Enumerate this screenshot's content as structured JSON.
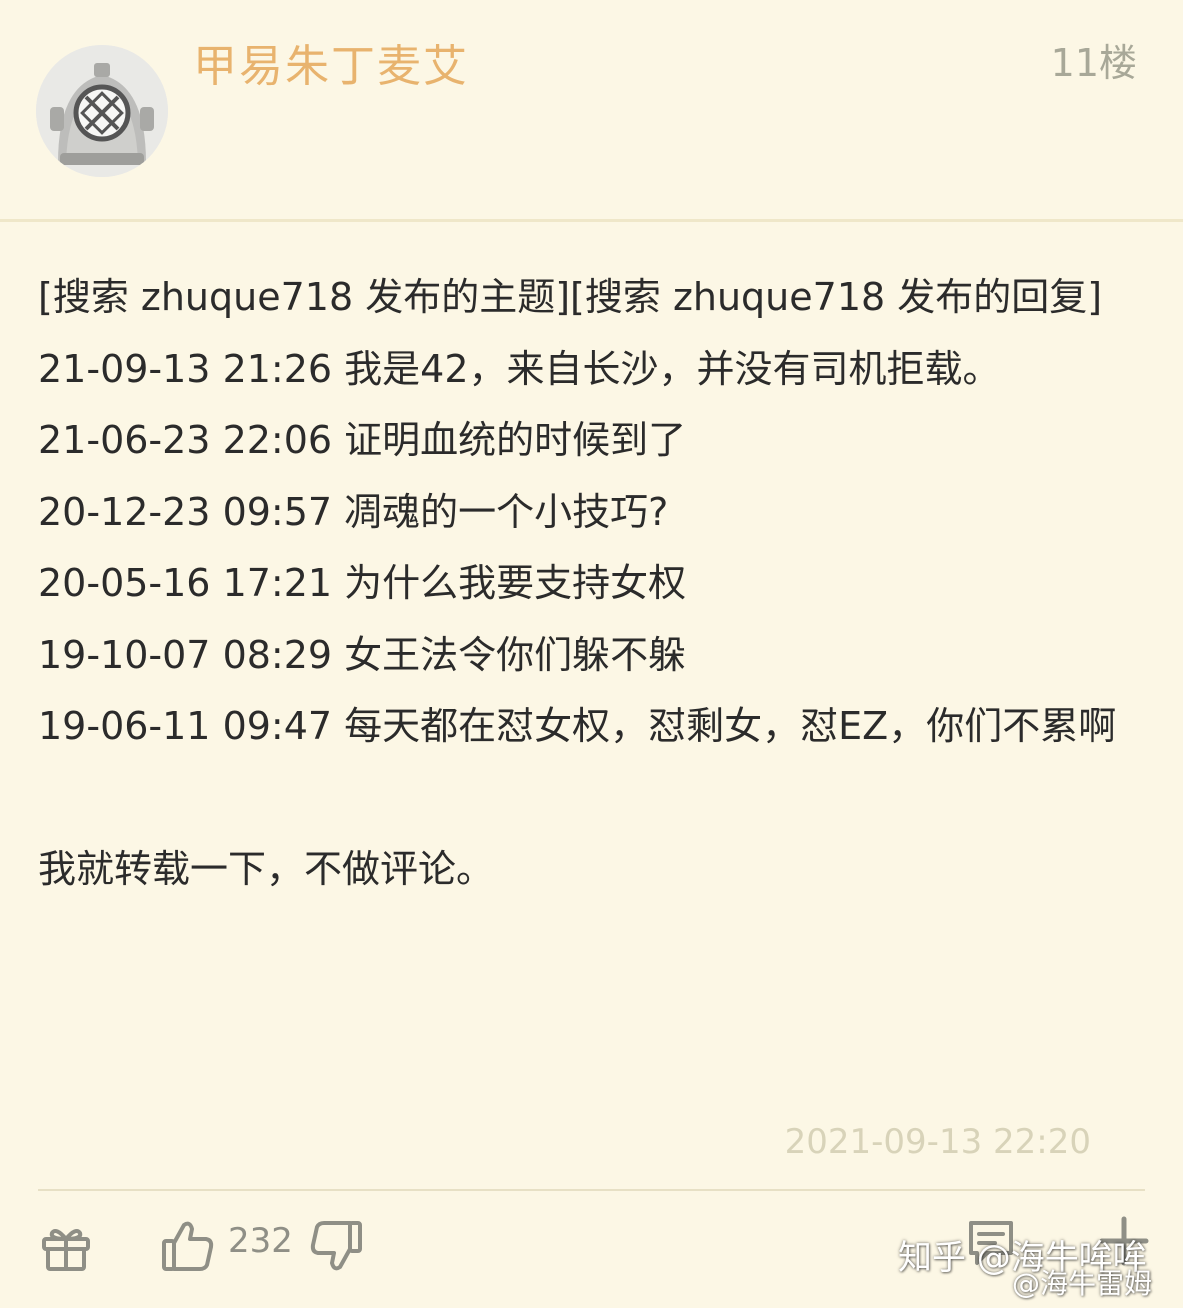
{
  "post": {
    "username": "甲易朱丁麦艾",
    "floor": "11楼",
    "lines": [
      "[搜索 zhuque718 发布的主题][搜索 zhuque718 发布的回复]",
      "21-09-13 21:26 我是42，来自长沙，并没有司机拒载。",
      "21-06-23 22:06 证明血统的时候到了",
      "20-12-23 09:57 凋魂的一个小技巧?",
      "20-05-16 17:21 为什么我要支持女权",
      "19-10-07 08:29 女王法令你们躲不躲",
      "19-06-11 09:47 每天都在怼女权，怼剩女，怼EZ，你们不累啊"
    ],
    "closing": "我就转载一下，不做评论。",
    "timestamp": "2021-09-13 22:20",
    "like_count": "232"
  },
  "watermark": {
    "line1": "知乎 @海牛哞哞",
    "line2": "@海牛雷姆"
  },
  "icons": {
    "avatar": "diving-helmet-avatar",
    "gift": "gift-icon",
    "like": "thumbs-up-icon",
    "dislike": "thumbs-down-icon",
    "comment": "comment-icon",
    "more": "plus-icon"
  },
  "colors": {
    "background": "#fcf7e5",
    "username": "#e8b36e",
    "floor": "#a8a898",
    "text": "#2b2b2b",
    "timestamp": "#d8d3b9",
    "icon": "#8f8f86"
  }
}
